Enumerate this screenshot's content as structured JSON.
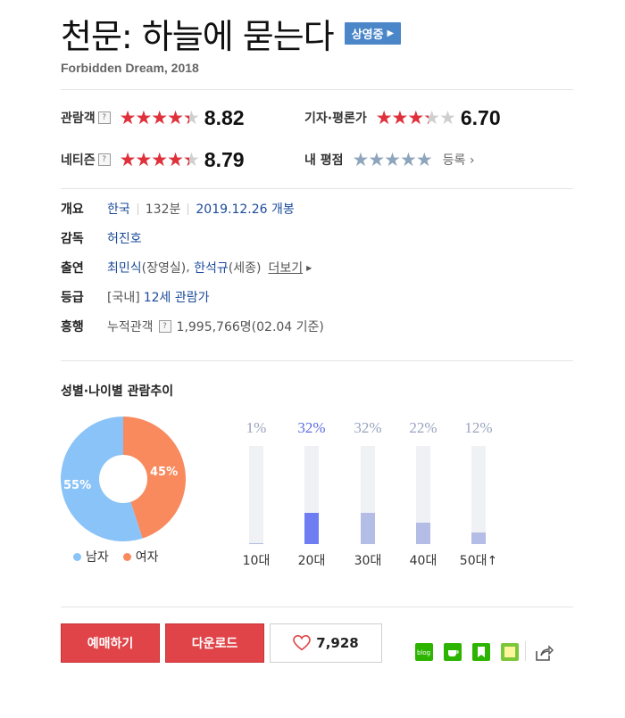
{
  "movie": {
    "title": "천문: 하늘에 묻는다",
    "status": "상영중",
    "subtitle": "Forbidden Dream, 2018"
  },
  "ratings": {
    "audience": {
      "label": "관람객",
      "score": "8.82",
      "value": 8.82
    },
    "critics": {
      "label": "기자·평론가",
      "score": "6.70",
      "value": 6.7
    },
    "netizen": {
      "label": "네티즌",
      "score": "8.79",
      "value": 8.79
    },
    "my": {
      "label": "내 평점",
      "action": "등록"
    }
  },
  "info": {
    "overview_key": "개요",
    "country": "한국",
    "runtime": "132분",
    "release": "2019.12.26 개봉",
    "director_key": "감독",
    "director": "허진호",
    "cast_key": "출연",
    "cast1": "최민식",
    "cast1_role": "(장영실)",
    "cast2": "한석규",
    "cast2_role": "(세종)",
    "more": "더보기",
    "grade_key": "등급",
    "grade_prefix": "[국내]",
    "grade": "12세 관람가",
    "box_key": "흥행",
    "box_label": "누적관객",
    "box_value": "1,995,766명(02.04 기준)"
  },
  "trend": {
    "title": "성별·나이별 관람추이",
    "gender": {
      "male_label": "남자",
      "female_label": "여자",
      "male_pct_text": "55%",
      "female_pct_text": "45%",
      "male_value": 55,
      "female_value": 45,
      "male_color": "#8ac3f7",
      "female_color": "#f88a5e"
    },
    "ages": [
      {
        "label": "10대",
        "pct": "1%",
        "value": 1,
        "highlight": false
      },
      {
        "label": "20대",
        "pct": "32%",
        "value": 32,
        "highlight": true
      },
      {
        "label": "30대",
        "pct": "32%",
        "value": 32,
        "highlight": false
      },
      {
        "label": "40대",
        "pct": "22%",
        "value": 22,
        "highlight": false
      },
      {
        "label": "50대↑",
        "pct": "12%",
        "value": 12,
        "highlight": false
      }
    ]
  },
  "actions": {
    "reserve": "예매하기",
    "download": "다운로드",
    "likes": "7,928"
  },
  "share_icons": [
    "blog-icon",
    "cafe-icon",
    "bookmark-icon",
    "memo-icon",
    "share-icon"
  ]
}
